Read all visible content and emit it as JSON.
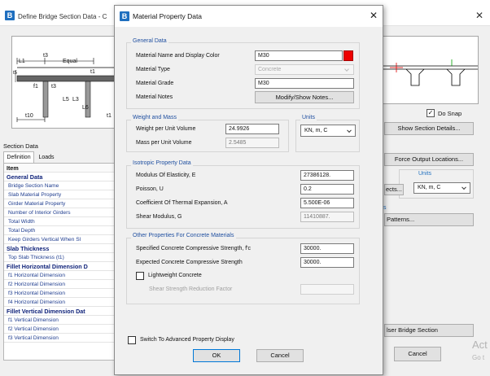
{
  "background_window": {
    "title": "Define Bridge Section Data - C",
    "diagram_labels": {
      "t3": "t3",
      "l1": "L1",
      "equal": "Equal",
      "t1": "t1",
      "f1": "f1",
      "t3b": "t3",
      "l5": "L5",
      "l3": "L3",
      "l6": "L6",
      "t10": "t10",
      "t1b": "t1"
    },
    "do_snap_checked": true,
    "do_snap_label": "Do Snap",
    "show_section_details_label": "Show Section Details...",
    "section_data_label": "Section Data",
    "tabs": [
      "Definition",
      "Loads"
    ],
    "grid_header": "Item",
    "grid_rows": [
      {
        "text": "General Data",
        "category": true
      },
      {
        "text": "Bridge Section Name",
        "category": false
      },
      {
        "text": "Slab Material Property",
        "category": false
      },
      {
        "text": "Girder Material Property",
        "category": false
      },
      {
        "text": "Number of Interior Girders",
        "category": false
      },
      {
        "text": "Total Width",
        "category": false
      },
      {
        "text": "Total Depth",
        "category": false
      },
      {
        "text": "Keep Girders Vertical When Sl",
        "category": false
      },
      {
        "text": "Slab Thickness",
        "category": true
      },
      {
        "text": "Top Slab Thickness (t1)",
        "category": false
      },
      {
        "text": "Fillet Horizontal Dimension D",
        "category": true
      },
      {
        "text": "f1 Horizontal Dimension",
        "category": false
      },
      {
        "text": "f2 Horizontal Dimension",
        "category": false
      },
      {
        "text": "f3 Horizontal Dimension",
        "category": false
      },
      {
        "text": "f4 Horizontal Dimension",
        "category": false
      },
      {
        "text": "Fillet Vertical Dimension Dat",
        "category": true
      },
      {
        "text": "f1 Vertical Dimension",
        "category": false
      },
      {
        "text": "f2 Vertical Dimension",
        "category": false
      },
      {
        "text": "f3 Vertical Dimension",
        "category": false
      }
    ],
    "force_output_button": "Force Output Locations...",
    "units_title": "Units",
    "units_value": "KN, m, C",
    "ects_button": "ects...",
    "side_label_s": "s",
    "patterns_button": "Patterns...",
    "user_bridge_section_button": "lser Bridge Section",
    "cancel_button": "Cancel",
    "watermark_line1": "Act",
    "watermark_line2": "Go t"
  },
  "dialog": {
    "title": "Material Property Data",
    "general": {
      "title": "General Data",
      "name_label": "Material Name and Display Color",
      "name_value": "M30",
      "color": "#ee0000",
      "type_label": "Material Type",
      "type_value": "Concrete",
      "grade_label": "Material Grade",
      "grade_value": "M30",
      "notes_label": "Material Notes",
      "notes_button": "Modify/Show Notes..."
    },
    "weight": {
      "title": "Weight and Mass",
      "weight_label": "Weight per Unit Volume",
      "weight_value": "24.9926",
      "mass_label": "Mass per Unit Volume",
      "mass_value": "2.5485"
    },
    "units": {
      "title": "Units",
      "value": "KN, m, C"
    },
    "isotropic": {
      "title": "Isotropic Property Data",
      "modulus_label": "Modulus Of Elasticity,  E",
      "modulus_value": "27386128.",
      "poisson_label": "Poisson,  U",
      "poisson_value": "0.2",
      "thermal_label": "Coefficient Of Thermal Expansion,  A",
      "thermal_value": "5.500E-06",
      "shear_label": "Shear Modulus,  G",
      "shear_value": "11410887."
    },
    "concrete": {
      "title": "Other Properties For Concrete Materials",
      "fc_label": "Specified Concrete Compressive Strength, f'c",
      "fc_value": "30000.",
      "expected_label": "Expected Concrete Compressive Strength",
      "expected_value": "30000.",
      "lightweight_label": "Lightweight Concrete",
      "lightweight_checked": false,
      "shear_reduction_label": "Shear Strength Reduction Factor"
    },
    "advanced_label": "Switch To Advanced Property Display",
    "advanced_checked": false,
    "ok_button": "OK",
    "cancel_button": "Cancel"
  }
}
